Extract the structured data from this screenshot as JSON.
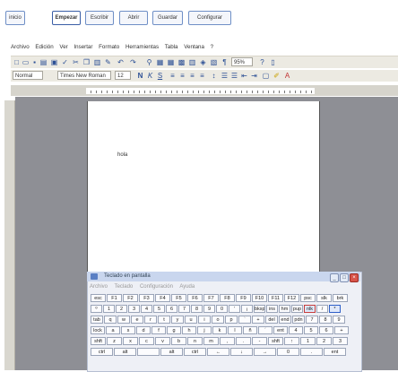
{
  "tabs": [
    {
      "label": "inicio"
    },
    {
      "label": "Empezar"
    },
    {
      "label": "Escribir"
    },
    {
      "label": "Abrir"
    },
    {
      "label": "Guardar"
    },
    {
      "label": "Configurar"
    }
  ],
  "menu": [
    "Archivo",
    "Edición",
    "Ver",
    "Insertar",
    "Formato",
    "Herramientas",
    "Tabla",
    "Ventana",
    "?"
  ],
  "toolbar": {
    "style_value": "Normal",
    "font_value": "Times New Roman",
    "size_value": "12",
    "zoom_value": "95%"
  },
  "document": {
    "text": "hola"
  },
  "osk": {
    "title": "Teclado en pantalla",
    "menu": [
      "Archivo",
      "Teclado",
      "Configuración",
      "Ayuda"
    ],
    "rows": [
      [
        "esc",
        "F1",
        "F2",
        "F3",
        "F4",
        "F5",
        "F6",
        "F7",
        "F8",
        "F9",
        "F10",
        "F11",
        "F12",
        "psc",
        "slk",
        "brk"
      ],
      [
        "º",
        "1",
        "2",
        "3",
        "4",
        "5",
        "6",
        "7",
        "8",
        "9",
        "0",
        "'",
        "¡",
        "bksp",
        "ins",
        "hm",
        "pup",
        "nlk",
        "/",
        "*"
      ],
      [
        "tab",
        "q",
        "w",
        "e",
        "r",
        "t",
        "y",
        "u",
        "i",
        "o",
        "p",
        "`",
        "+",
        "del",
        "end",
        "pdn",
        "7",
        "8",
        "9"
      ],
      [
        "lock",
        "a",
        "s",
        "d",
        "f",
        "g",
        "h",
        "j",
        "k",
        "l",
        "ñ",
        "´",
        "ent",
        "4",
        "5",
        "6",
        "+"
      ],
      [
        "shft",
        "z",
        "x",
        "c",
        "v",
        "b",
        "n",
        "m",
        ",",
        ".",
        "-",
        "shft",
        "↑",
        "1",
        "2",
        "3"
      ],
      [
        "ctrl",
        "alt",
        "",
        "alt",
        "ctrl",
        "←",
        "↓",
        "→",
        "0",
        ".",
        "ent"
      ]
    ]
  },
  "colors": {
    "accent": "#3a5ea6",
    "workspace": "#8e8f95"
  }
}
